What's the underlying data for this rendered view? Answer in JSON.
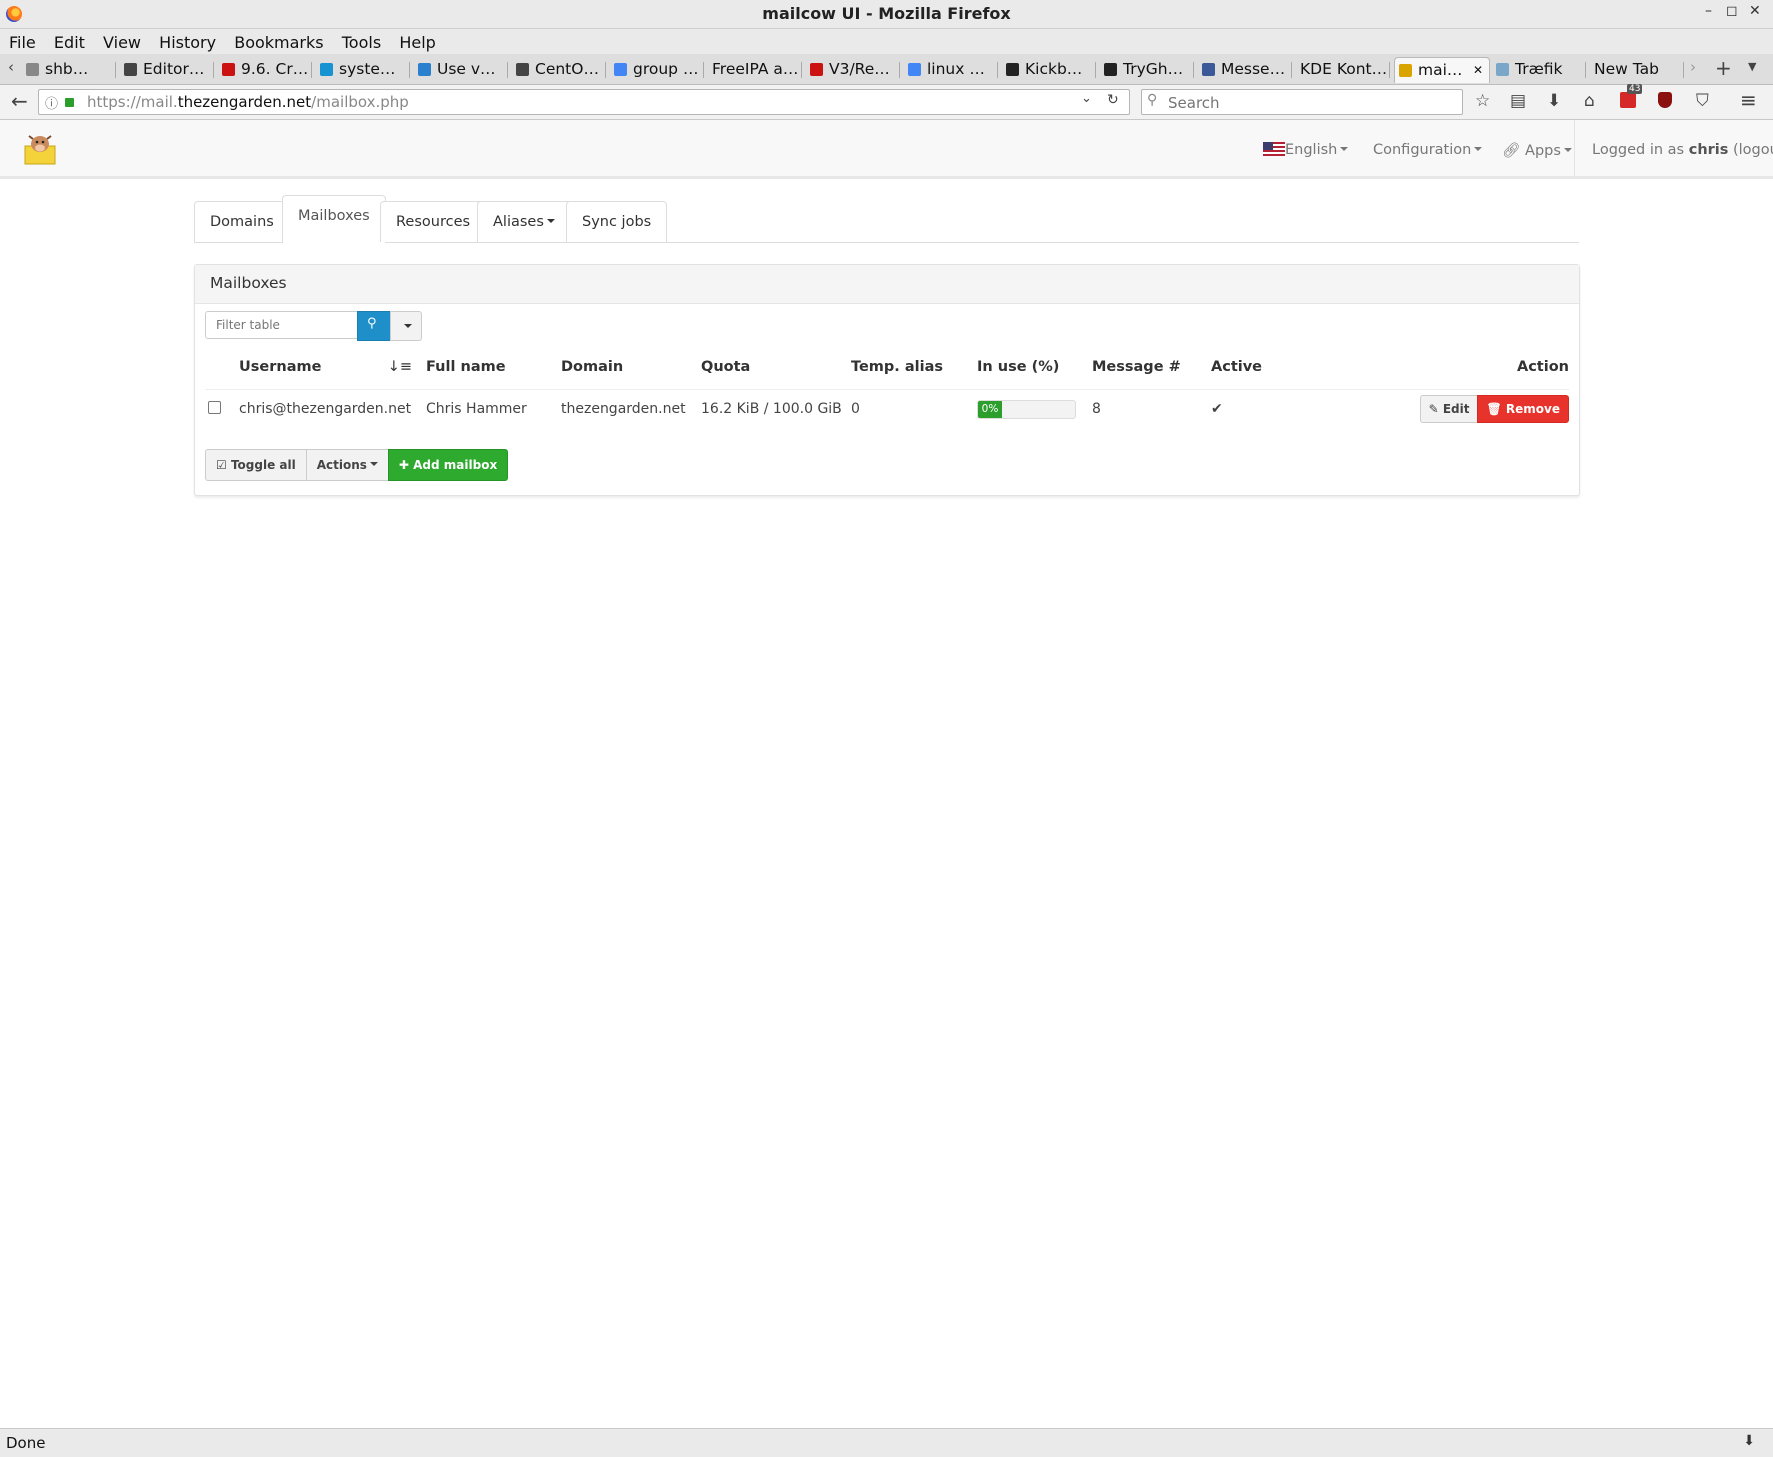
{
  "window": {
    "title": "mailcow UI - Mozilla Firefox",
    "controls": [
      "–",
      "◻",
      "✕"
    ]
  },
  "menubar": [
    "File",
    "Edit",
    "View",
    "History",
    "Bookmarks",
    "Tools",
    "Help"
  ],
  "tabs": [
    {
      "label": "shb…",
      "color": "#888888"
    },
    {
      "label": "Editor…",
      "color": "#444444"
    },
    {
      "label": "9.6. Cr…",
      "color": "#cc1111"
    },
    {
      "label": "syste…",
      "color": "#1793d1"
    },
    {
      "label": "Use v…",
      "color": "#2a7fcf"
    },
    {
      "label": "CentO…",
      "color": "#444444"
    },
    {
      "label": "group …",
      "color": "#4285f4"
    },
    {
      "label": "FreeIPA a…",
      "color": ""
    },
    {
      "label": "V3/Re…",
      "color": "#cc1111"
    },
    {
      "label": "linux …",
      "color": "#4285f4"
    },
    {
      "label": "Kickb…",
      "color": "#222222"
    },
    {
      "label": "TryGh…",
      "color": "#222222"
    },
    {
      "label": "Messe…",
      "color": "#3b5998"
    },
    {
      "label": "KDE Kont…",
      "color": ""
    },
    {
      "label": "mai…",
      "color": "#d9a300",
      "active": true
    },
    {
      "label": "Træfik",
      "color": "#7aa7c7"
    },
    {
      "label": "New Tab",
      "color": ""
    }
  ],
  "url": {
    "prefix": "https://mail.",
    "domain": "thezengarden.net",
    "path": "/mailbox.php"
  },
  "search": {
    "placeholder": "Search"
  },
  "addon_badge": "43",
  "app_header": {
    "language": "English",
    "configuration": "Configuration",
    "apps": "Apps",
    "logged_in_prefix": "Logged in as ",
    "user": "chris",
    "logout": "(logout)"
  },
  "nav_tabs": [
    "Domains",
    "Mailboxes",
    "Resources",
    "Aliases",
    "Sync jobs"
  ],
  "panel": {
    "title": "Mailboxes",
    "filter_placeholder": "Filter table",
    "columns": [
      "Username",
      "Full name",
      "Domain",
      "Quota",
      "Temp. alias",
      "In use (%)",
      "Message #",
      "Active",
      "Action"
    ],
    "rows": [
      {
        "username": "chris@thezengarden.net",
        "full_name": "Chris Hammer",
        "domain": "thezengarden.net",
        "quota": "16.2 KiB / 100.0 GiB",
        "temp_alias": "0",
        "in_use_label": "0%",
        "in_use_fraction": 0.0,
        "messages": "8",
        "active": "✔",
        "edit_label": "Edit",
        "remove_label": "Remove"
      }
    ],
    "footer": {
      "toggle_all": "Toggle all",
      "actions": "Actions",
      "add_mailbox": "Add mailbox"
    }
  },
  "status": "Done",
  "colors": {
    "primary_blue": "#1e8fc8",
    "success_green": "#2eaa2e",
    "danger_red": "#e8322c"
  }
}
